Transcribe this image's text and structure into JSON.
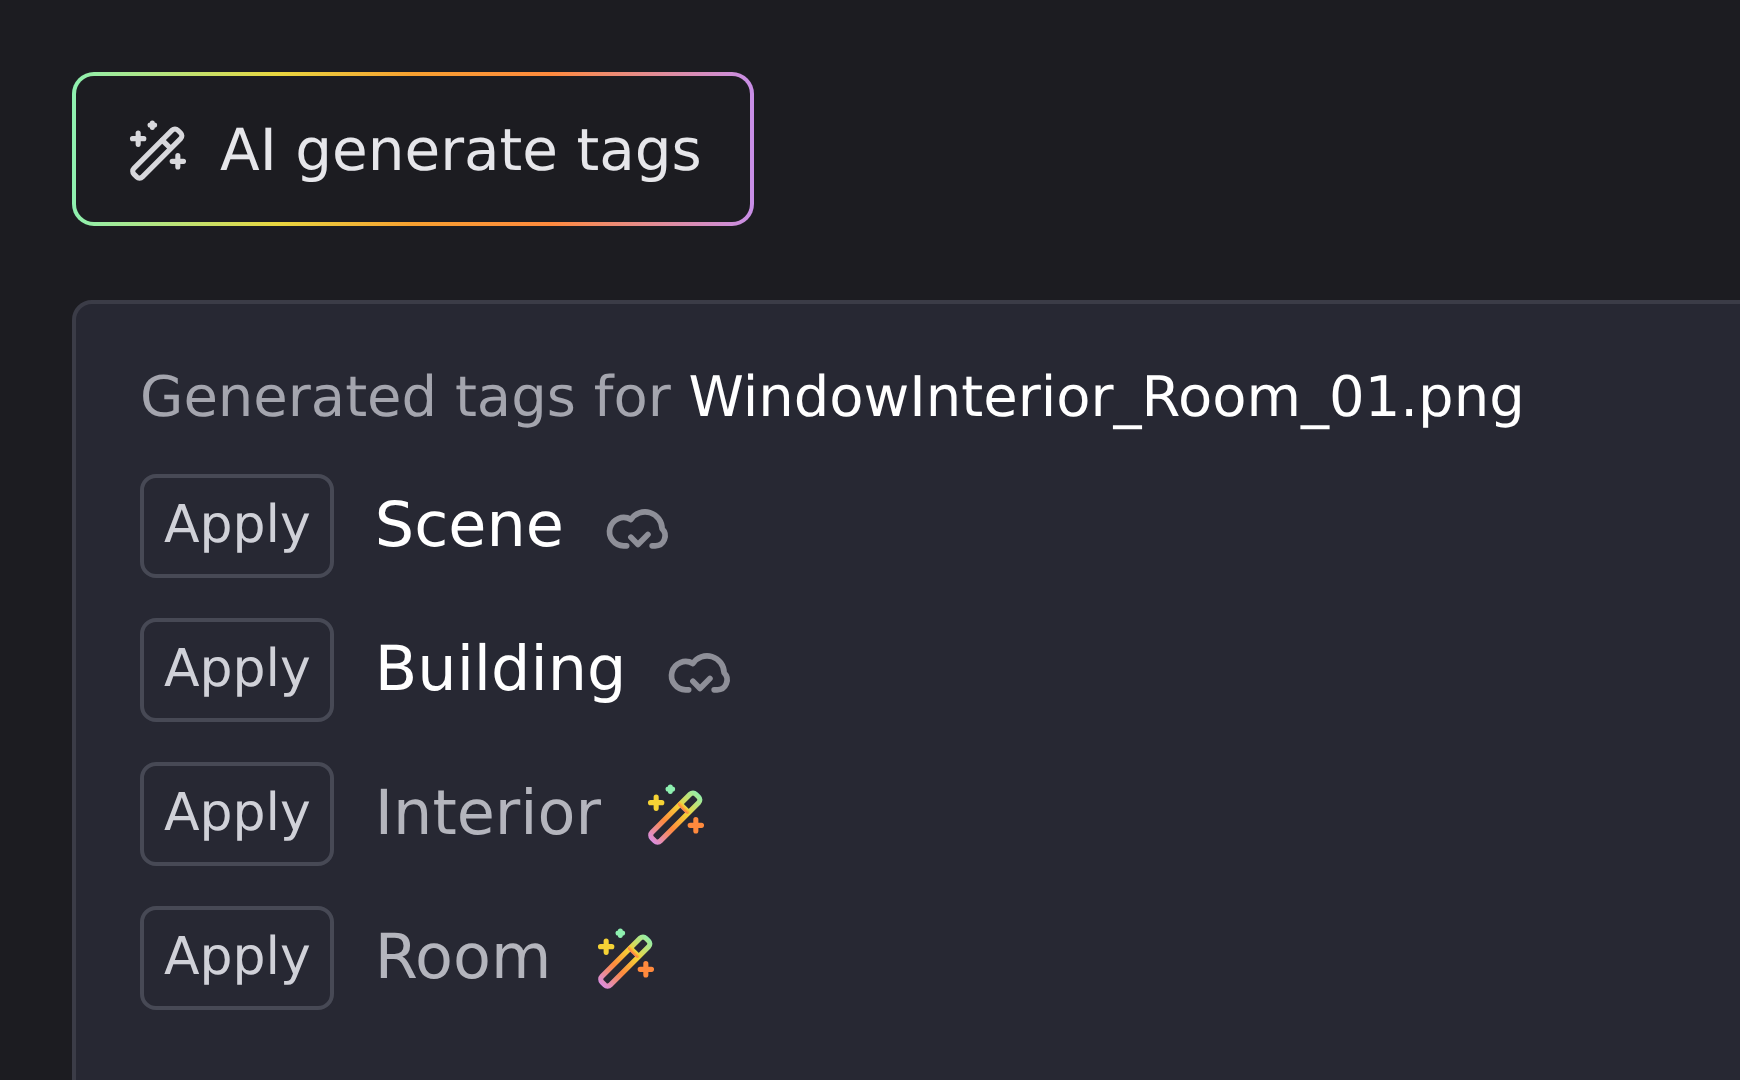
{
  "generate_button": {
    "label": "AI generate tags"
  },
  "panel": {
    "title": "Generated tags for **WindowInterior_Room_01.png**",
    "tags": [
      {
        "action": "Apply",
        "name": "Scene",
        "kind": "existing"
      },
      {
        "action": "Apply",
        "name": "Building",
        "kind": "existing"
      },
      {
        "action": "Apply",
        "name": "Interior",
        "kind": "ai"
      },
      {
        "action": "Apply",
        "name": "Room",
        "kind": "ai"
      }
    ]
  }
}
